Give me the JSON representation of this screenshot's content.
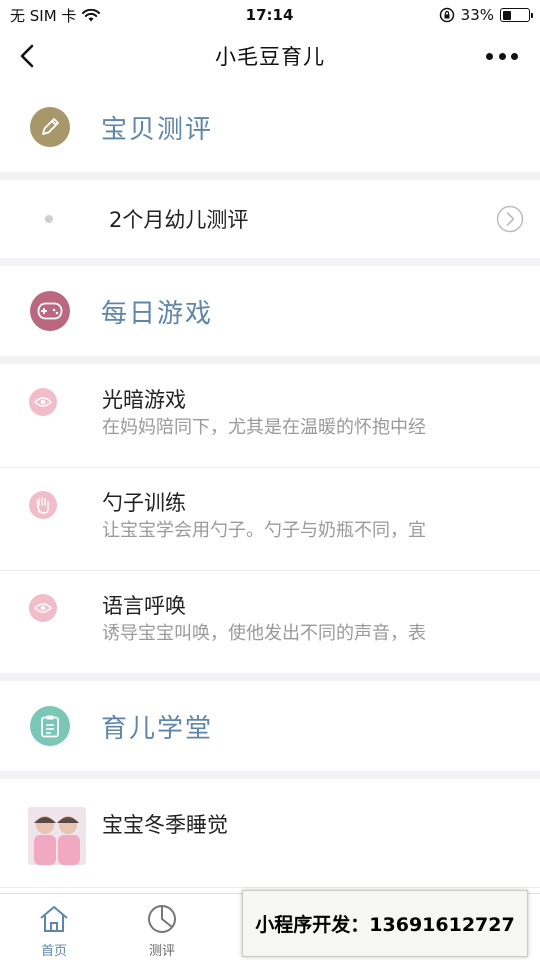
{
  "status_bar": {
    "carrier": "无 SIM 卡",
    "time": "17:14",
    "battery_percent": "33%",
    "battery_level": 0.33
  },
  "nav": {
    "title": "小毛豆育儿"
  },
  "sections": {
    "evaluation": {
      "title": "宝贝测评",
      "icon": "pencil-icon",
      "color": "#a8976a",
      "items": [
        {
          "label": "2个月幼儿测评"
        }
      ]
    },
    "games": {
      "title": "每日游戏",
      "icon": "gamepad-icon",
      "color": "#b9687f",
      "items": [
        {
          "title": "光暗游戏",
          "desc": "在妈妈陪同下，尤其是在温暖的怀抱中经",
          "icon": "eye-icon"
        },
        {
          "title": "勺子训练",
          "desc": "让宝宝学会用勺子。勺子与奶瓶不同，宜",
          "icon": "hand-icon"
        },
        {
          "title": "语言呼唤",
          "desc": "诱导宝宝叫唤，使他发出不同的声音，表",
          "icon": "eye-icon"
        }
      ]
    },
    "school": {
      "title": "育儿学堂",
      "icon": "clipboard-icon",
      "color": "#7cc6b8",
      "items": [
        {
          "title": "宝宝冬季睡觉"
        }
      ]
    }
  },
  "tabs": [
    {
      "label": "首页",
      "icon": "home-icon",
      "active": true
    },
    {
      "label": "测评",
      "icon": "pie-chart-icon",
      "active": false
    }
  ],
  "promo": {
    "text": "小程序开发：13691612727"
  },
  "colors": {
    "accent": "#5f86a8",
    "background": "#f3f3f6"
  }
}
